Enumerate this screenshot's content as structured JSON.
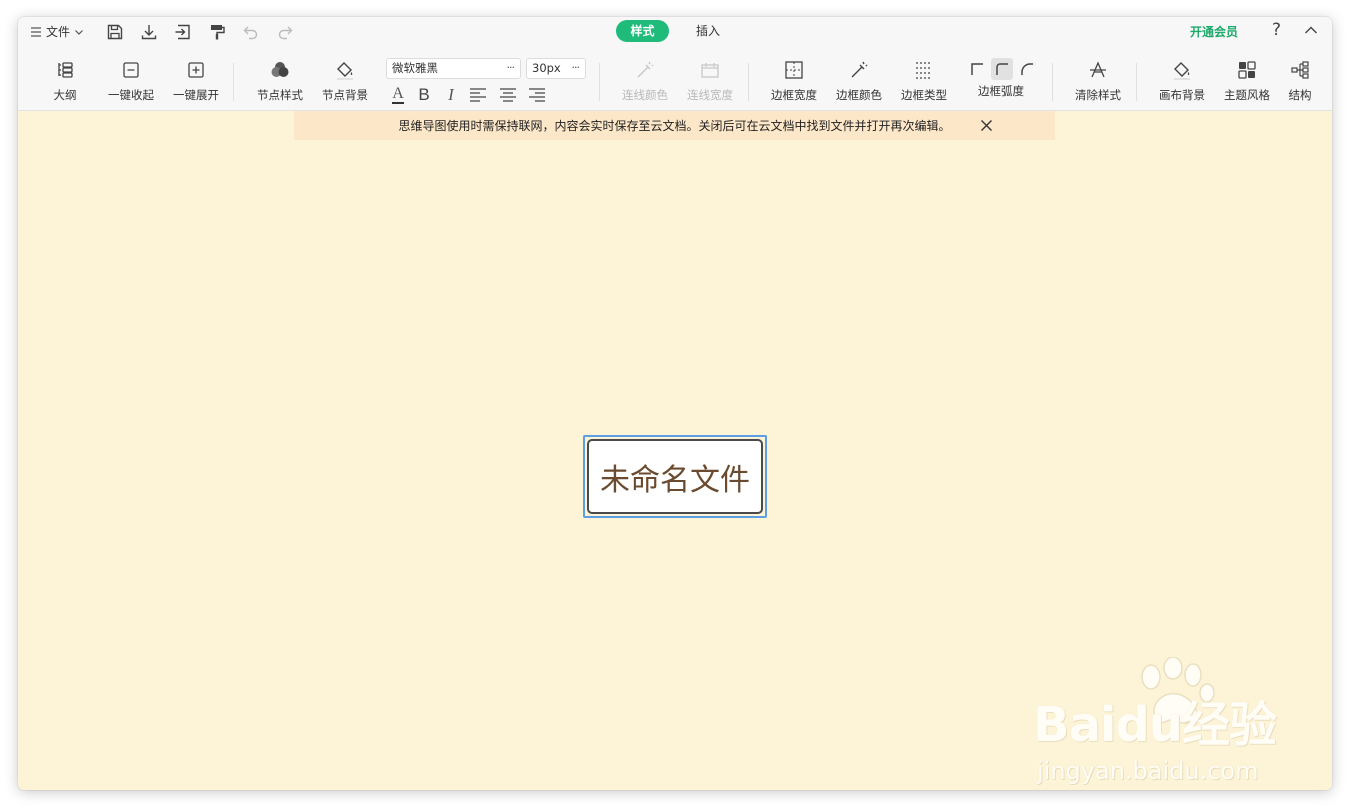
{
  "titlebar": {
    "file_menu_label": "文件",
    "tabs": [
      {
        "label": "样式",
        "active": true
      },
      {
        "label": "插入",
        "active": false
      }
    ],
    "vip_label": "开通会员",
    "help_label": "?"
  },
  "toolbar": {
    "outline": "大纲",
    "collapse_all": "一键收起",
    "expand_all": "一键展开",
    "node_style": "节点样式",
    "node_background": "节点背景",
    "font_family": "微软雅黑",
    "font_size": "30px",
    "more_glyph": "···",
    "format": {
      "font_color": "A",
      "bold": "B",
      "italic": "I"
    },
    "line_color": "连线颜色",
    "line_width": "连线宽度",
    "border_width": "边框宽度",
    "border_color": "边框颜色",
    "border_type": "边框类型",
    "border_radius": "边框弧度",
    "clear_style": "清除样式",
    "canvas_background": "画布背景",
    "theme_style": "主题风格",
    "structure": "结构"
  },
  "notice": {
    "text": "思维导图使用时需保持联网，内容会实时保存至云文档。关闭后可在云文档中找到文件并打开再次编辑。"
  },
  "canvas": {
    "root_node_text": "未命名文件",
    "background_color": "#fdf4d7"
  },
  "watermark": {
    "brand": "Baidu经验",
    "url": "jingyan.baidu.com"
  },
  "colors": {
    "accent": "#1fbb7a",
    "vip": "#1fa96c",
    "notice_bg": "#fde7c9",
    "selection": "#5b9ee6"
  }
}
